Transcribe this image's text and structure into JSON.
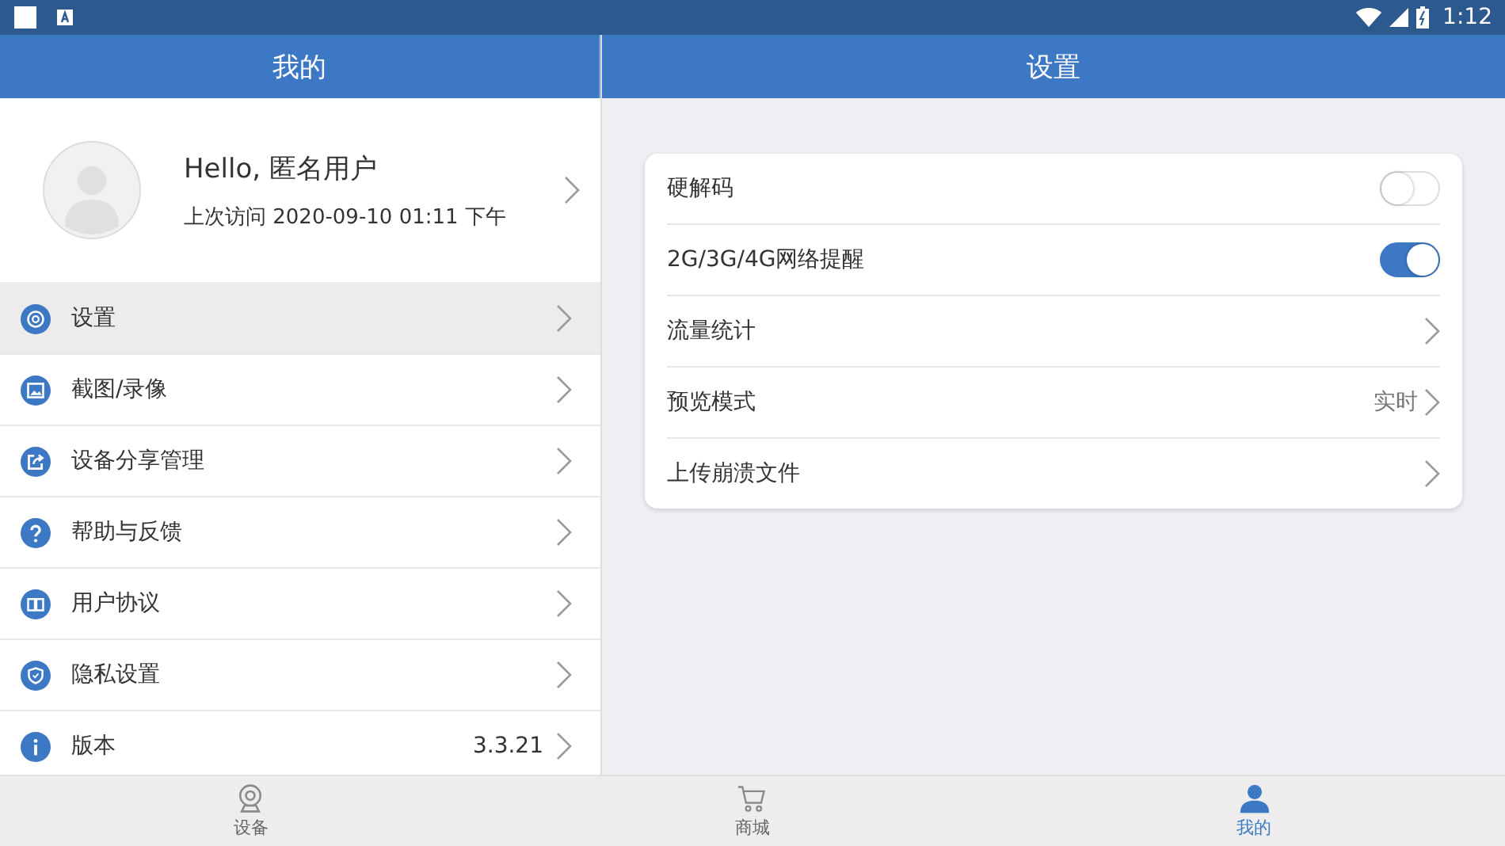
{
  "status_bar": {
    "time": "1:12"
  },
  "left_panel": {
    "title": "我的",
    "profile": {
      "greeting": "Hello, 匿名用户",
      "last_visit": "上次访问 2020-09-10 01:11 下午"
    },
    "menu": [
      {
        "kind": "settings",
        "label": "设置",
        "selected": true
      },
      {
        "kind": "image",
        "label": "截图/录像",
        "selected": false
      },
      {
        "kind": "share",
        "label": "设备分享管理",
        "selected": false
      },
      {
        "kind": "help",
        "label": "帮助与反馈",
        "selected": false
      },
      {
        "kind": "book",
        "label": "用户协议",
        "selected": false
      },
      {
        "kind": "shield",
        "label": "隐私设置",
        "selected": false
      },
      {
        "kind": "info",
        "label": "版本",
        "value": "3.3.21",
        "selected": false
      }
    ]
  },
  "right_panel": {
    "title": "设置",
    "settings": [
      {
        "kind": "toggle",
        "label": "硬解码",
        "on": false
      },
      {
        "kind": "toggle",
        "label": "2G/3G/4G网络提醒",
        "on": true
      },
      {
        "kind": "link",
        "label": "流量统计"
      },
      {
        "kind": "link",
        "label": "预览模式",
        "value": "实时"
      },
      {
        "kind": "link",
        "label": "上传崩溃文件"
      }
    ]
  },
  "bottom_nav": [
    {
      "kind": "camera",
      "label": "设备",
      "selected": false
    },
    {
      "kind": "cart",
      "label": "商城",
      "selected": false
    },
    {
      "kind": "person",
      "label": "我的",
      "selected": true
    }
  ]
}
